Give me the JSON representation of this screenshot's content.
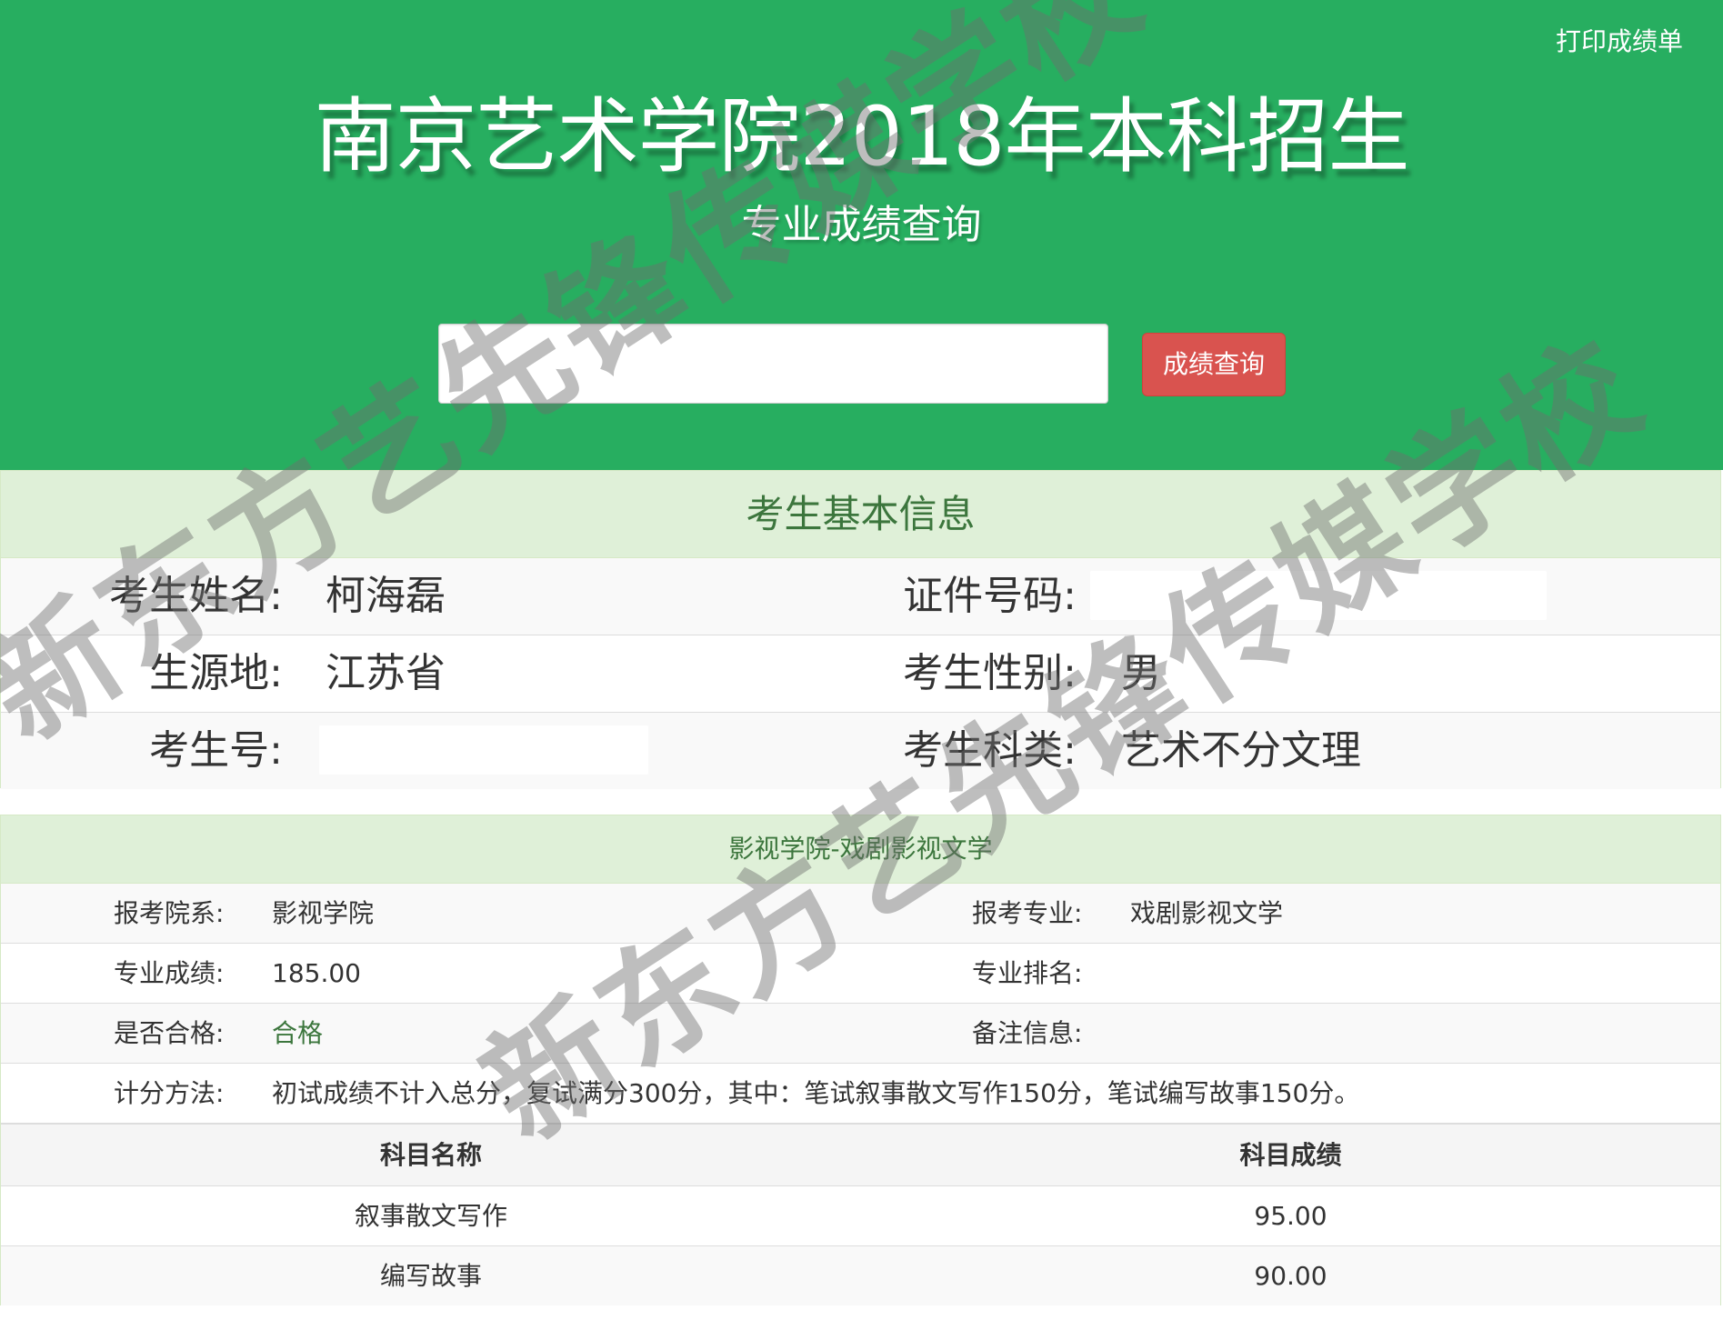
{
  "header": {
    "print_label": "打印成绩单",
    "title": "南京艺术学院2018年本科招生",
    "subtitle": "专业成绩查询",
    "search": {
      "value": "",
      "placeholder": ""
    },
    "search_button_label": "成绩查询"
  },
  "basic_info": {
    "heading": "考生基本信息",
    "rows": [
      {
        "left_label": "考生姓名:",
        "left_value": "柯海磊",
        "right_label": "证件号码:",
        "right_value": ""
      },
      {
        "left_label": "生源地:",
        "left_value": "江苏省",
        "right_label": "考生性别:",
        "right_value": "男"
      },
      {
        "left_label": "考生号:",
        "left_value": "",
        "right_label": "考生科类:",
        "right_value": "艺术不分文理"
      }
    ]
  },
  "score_panel": {
    "heading": "影视学院-戏剧影视文学",
    "rows": [
      {
        "left_label": "报考院系:",
        "left_value": "影视学院",
        "right_label": "报考专业:",
        "right_value": "戏剧影视文学"
      },
      {
        "left_label": "专业成绩:",
        "left_value": "185.00",
        "right_label": "专业排名:",
        "right_value": ""
      },
      {
        "left_label": "是否合格:",
        "left_value": "合格",
        "right_label": "备注信息:",
        "right_value": ""
      }
    ],
    "method_label": "计分方法:",
    "method_value": "初试成绩不计入总分，复试满分300分，其中：笔试叙事散文写作150分，笔试编写故事150分。",
    "subject_table": {
      "headers": [
        "科目名称",
        "科目成绩"
      ],
      "rows": [
        [
          "叙事散文写作",
          "95.00"
        ],
        [
          "编写故事",
          "90.00"
        ]
      ]
    }
  },
  "watermark": {
    "text": "新东方艺先锋传媒学校"
  },
  "colors": {
    "header_green": "#27ae60",
    "panel_heading_bg": "#dff0d8",
    "panel_heading_text": "#3c763d",
    "button_red": "#d9534f",
    "pass_green": "#3c763d"
  }
}
